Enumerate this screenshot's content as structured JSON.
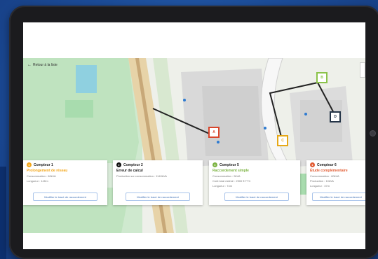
{
  "side_caption": "",
  "map": {
    "back_link": "Retour à la liste",
    "markers": [
      {
        "label": "A",
        "color": "#d9462c"
      },
      {
        "label": "B",
        "color": "#8bc34a"
      },
      {
        "label": "C",
        "color": "#e6a817"
      },
      {
        "label": "D",
        "color": "#243447"
      }
    ],
    "attribution": ""
  },
  "cards": [
    {
      "title": "Compteur 1",
      "dot_color": "#f3a71b",
      "subtitle": "Prolongement de réseau",
      "subtitle_color": "#f3a71b",
      "lines": [
        "Consommation : 60kVA",
        "Longueur : 14Km"
      ],
      "button": "Modifier le tracé de raccordement"
    },
    {
      "title": "Compteur 2",
      "dot_color": "#111111",
      "subtitle": "Erreur de calcul",
      "subtitle_color": "#222222",
      "lines": [
        "Production sur consommation : 1140kVA"
      ],
      "button": "Modifier le tracé de raccordement"
    },
    {
      "title": "Compteur 5",
      "dot_color": "#7cb342",
      "subtitle": "Raccordement simple",
      "subtitle_color": "#7cb342",
      "lines": [
        "Consommation : 9kVA",
        "Coût total estimé : 2900 € TTC",
        "Longueur : 74m"
      ],
      "button": "Modifier le tracé de raccordement"
    },
    {
      "title": "Compteur 6",
      "dot_color": "#e25b32",
      "subtitle": "Étude complémentaire",
      "subtitle_color": "#e25b32",
      "lines": [
        "Consommation : 60kVA",
        "Production : 10kVA",
        "Longueur : 37m"
      ],
      "button": "Modifier le tracé de raccordement"
    }
  ]
}
